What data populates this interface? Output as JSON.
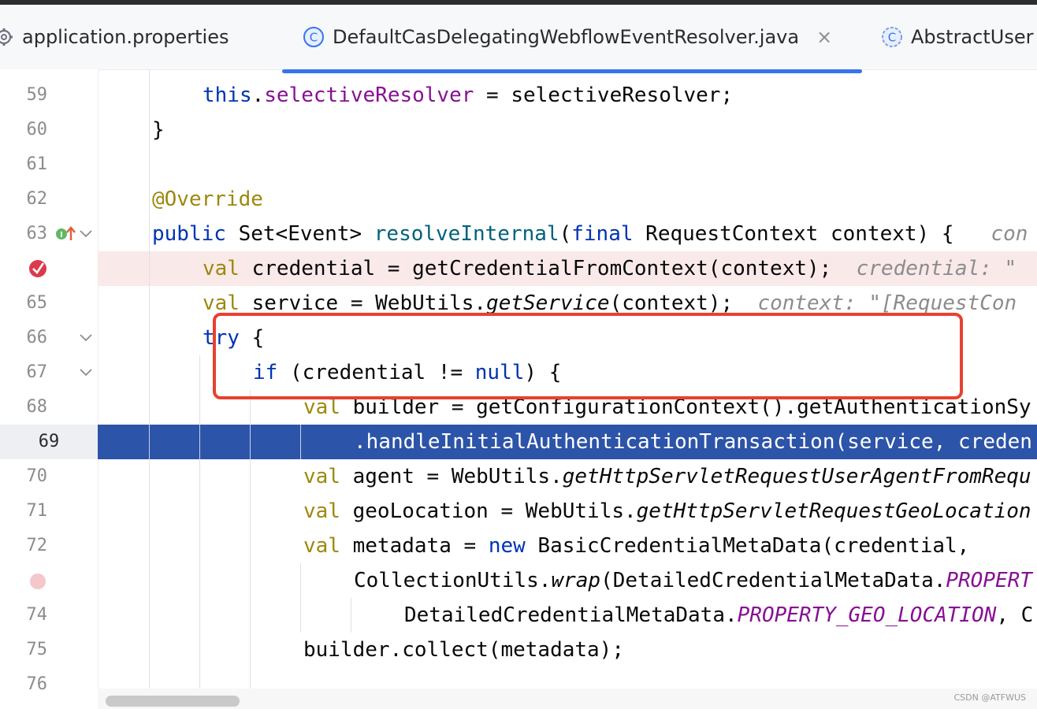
{
  "tabs": [
    {
      "label": "application.properties",
      "icon": "gear-icon"
    },
    {
      "label": "DefaultCasDelegatingWebflowEventResolver.java",
      "icon": "class-icon",
      "active": true,
      "close": "×"
    },
    {
      "label": "AbstractUser",
      "icon": "class-icon"
    }
  ],
  "colors": {
    "accent": "#3574f0",
    "execution_line": "#2c54a8",
    "breakpoint_line": "#fae9e9",
    "highlight_box": "#e8412f"
  },
  "lines": {
    "59": {
      "no": "59",
      "this": "this",
      "dot": ".",
      "field": "selectiveResolver",
      "rest": " = selectiveResolver;"
    },
    "60": {
      "no": "60",
      "text": "}"
    },
    "61": {
      "no": "61"
    },
    "62": {
      "no": "62",
      "annotation": "@Override"
    },
    "63": {
      "no": "63",
      "kw_public": "public",
      "t1": " Set<Event> ",
      "method": "resolveInternal",
      "t2": "(",
      "kw_final": "final",
      "t3": " RequestContext context) {",
      "hint": "   con"
    },
    "64": {
      "no": "",
      "kw": "val",
      "t1": " credential = getCredentialFromContext(context);",
      "hint": "  credential: \""
    },
    "65": {
      "no": "65",
      "kw": "val",
      "t1": " service = WebUtils.",
      "method": "getService",
      "t2": "(context);",
      "hint": "  context: \"[RequestCon"
    },
    "66": {
      "no": "66",
      "kw": "try",
      "t1": " {"
    },
    "67": {
      "no": "67",
      "kw_if": "if",
      "t1": " (credential != ",
      "kw_null": "null",
      "t2": ") {"
    },
    "68": {
      "no": "68",
      "kw": "val",
      "t1": " builder = getConfigurationContext().getAuthenticationSy"
    },
    "69": {
      "no": "69",
      "t1": ".handleInitialAuthenticationTransaction(service, creden"
    },
    "70": {
      "no": "70",
      "kw": "val",
      "t1": " agent = WebUtils.",
      "method": "getHttpServletRequestUserAgentFromRequ"
    },
    "71": {
      "no": "71",
      "kw": "val",
      "t1": " geoLocation = WebUtils.",
      "method": "getHttpServletRequestGeoLocation"
    },
    "72": {
      "no": "72",
      "kw": "val",
      "t1": " metadata = ",
      "kw_new": "new",
      "t2": " BasicCredentialMetaData(credential,"
    },
    "73": {
      "no": "",
      "t1": "CollectionUtils.",
      "method": "wrap",
      "t2": "(DetailedCredentialMetaData.",
      "const": "PROPERT"
    },
    "74": {
      "no": "74",
      "t1": "DetailedCredentialMetaData.",
      "const": "PROPERTY_GEO_LOCATION",
      "t2": ", C"
    },
    "75": {
      "no": "75",
      "t1": "builder.collect(metadata);"
    },
    "76": {
      "no": "76"
    }
  },
  "watermark": "CSDN @ATFWUS"
}
